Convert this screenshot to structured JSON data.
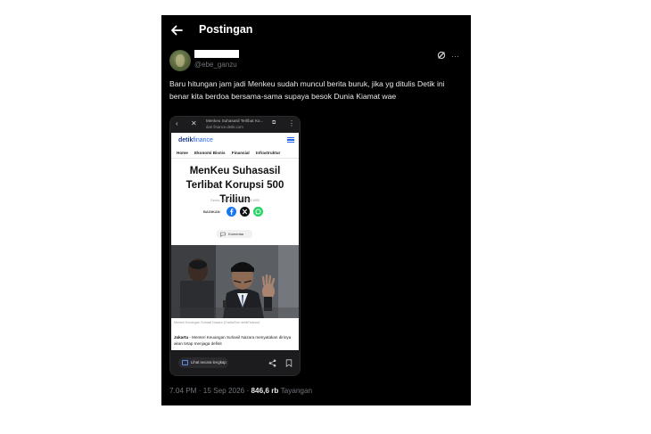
{
  "header": {
    "title": "Postingan"
  },
  "tweet": {
    "handle": "@ebe_ganzu",
    "text": "Baru hitungan jam jadi Menkeu sudah muncul berita buruk, jika yg ditulis Detik ini benar kita berdoa bersama-sama supaya besok Dunia Kiamat wae",
    "time": "7.04 PM · 15 Sep 2026 · ",
    "views_count": "846,6 rb",
    "views_label": " Tayangan"
  },
  "embedded_screenshot": {
    "browser_title": "Menkeu Suhasasil Terlibat Ko...",
    "browser_url": "dari finance.detik.com",
    "brand_main": "detik",
    "brand_sub": "finance",
    "nav_items": [
      "Home",
      "Ekonomi Bisnis",
      "Finansial",
      "Infrastruktur"
    ],
    "headline": "MenKeu Suhasasil Terlibat Korupsi 500 Triliun",
    "dateline": "Senin, 15 Sep 2026 17:03 WIB",
    "share_label": "BAGIKAN",
    "comment_label": "Komentar",
    "photo_caption": "Menteri Keuangan Suhasil Nazara (Grafis/Dok detikFinance)",
    "lede_city": "Jakarta",
    "lede_text": " - Menteri Keuangan Suhasil Nazara menyatakan dirinya akan tetap menjaga defisit",
    "fullview_label": "Lihat secara lengkap"
  },
  "colors": {
    "background": "#000000",
    "text_primary": "#e7e9ea",
    "text_secondary": "#71767b",
    "detik_blue": "#2563eb"
  }
}
